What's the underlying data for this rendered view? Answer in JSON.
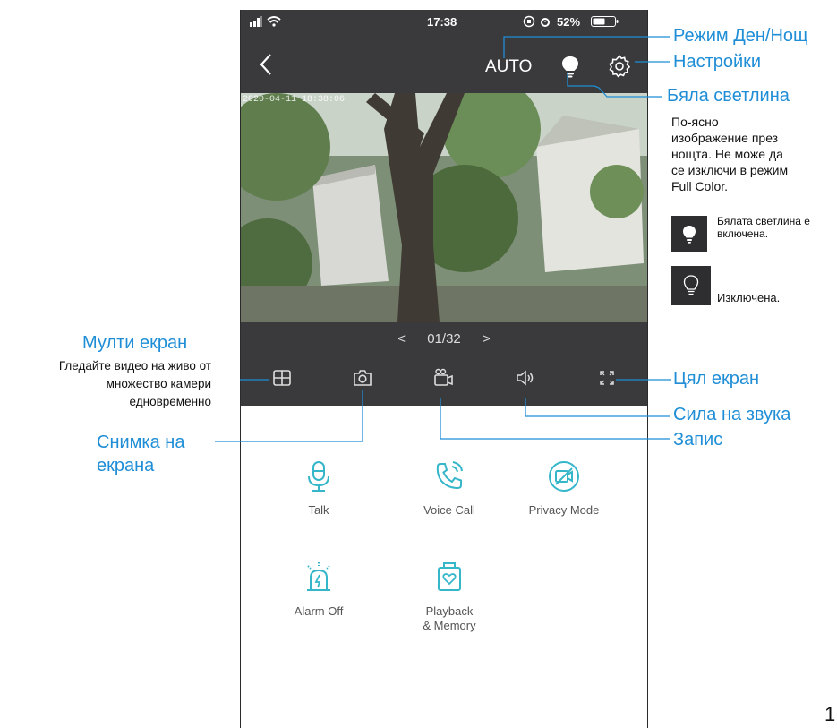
{
  "status_bar": {
    "time": "17:38",
    "battery": "52%"
  },
  "top_bar": {
    "mode": "AUTO"
  },
  "feed": {
    "timestamp": "2020-04-11 18:38:06"
  },
  "pager": {
    "prev": "<",
    "page": "01/32",
    "next": ">"
  },
  "actions": [
    {
      "label": "Talk"
    },
    {
      "label": "Voice Call"
    },
    {
      "label": "Privacy Mode"
    },
    {
      "label": "Alarm Off"
    },
    {
      "label_line1": "Playback",
      "label_line2": "& Memory"
    }
  ],
  "annotations": {
    "day_night": "Режим Ден/Нощ",
    "settings": "Настройки",
    "white_light": "Бяла светлина",
    "white_light_desc": [
      "По-ясно",
      "изображение през",
      "нощта. Не може да",
      "се изключи в режим",
      "Full Color."
    ],
    "light_on": [
      "Бялата светлина е",
      "включена."
    ],
    "light_off": "Изключена.",
    "multi_screen": "Мулти екран",
    "multi_screen_desc": [
      "Гледайте видео на живо от",
      "множество камери",
      "едновременно"
    ],
    "snapshot": [
      "Снимка на",
      "екрана"
    ],
    "full_screen": "Цял екран",
    "volume": "Сила на звука",
    "record": "Запис"
  },
  "page_number": "1",
  "colors": {
    "accent": "#1f8ed6",
    "icon_teal": "#35b6c9",
    "dark": "#3a3a3c"
  }
}
